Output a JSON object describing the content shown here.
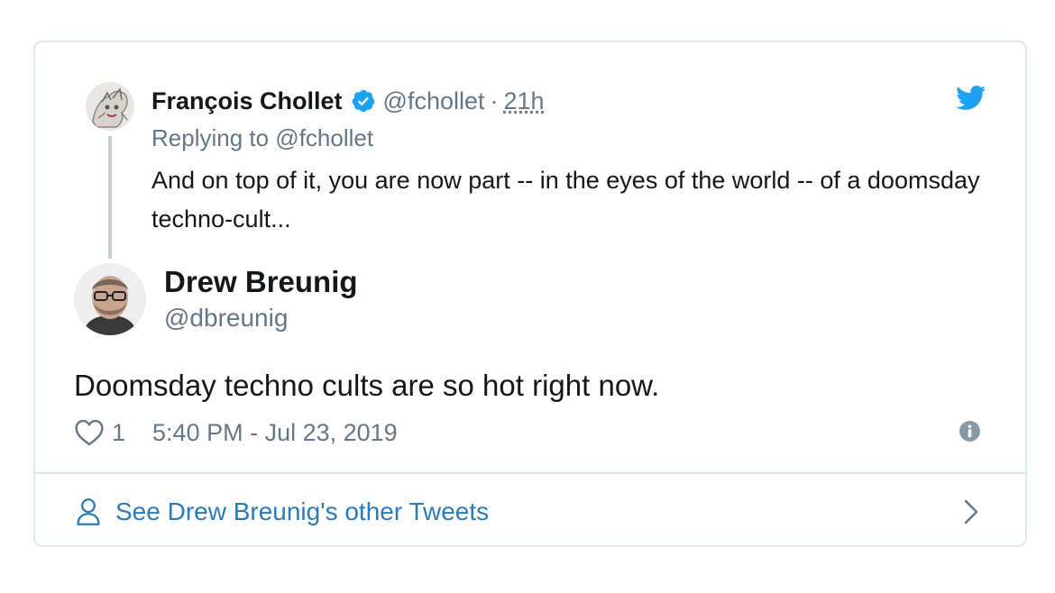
{
  "parent_tweet": {
    "author_name": "François Chollet",
    "author_handle": "@fchollet",
    "separator": "·",
    "relative_time": "21h",
    "replying_to": "Replying to @fchollet",
    "text": "And on top of it, you are now part -- in the eyes of the world -- of a doomsday techno-cult...",
    "verified_icon": "verified-badge-icon",
    "avatar_icon": "avatar"
  },
  "main_tweet": {
    "author_name": "Drew Breunig",
    "author_handle": "@dbreunig",
    "text": "Doomsday techno cults are so hot right now.",
    "like_count": "1",
    "timestamp": "5:40 PM - Jul 23, 2019",
    "like_icon": "heart-icon",
    "info_icon": "info-icon"
  },
  "footer": {
    "link_label": "See Drew Breunig's other Tweets",
    "link_icon": "person-icon",
    "chevron_icon": "chevron-right-icon"
  },
  "brand": {
    "logo_icon": "twitter-bird-icon",
    "accent_color": "#1da1f2",
    "link_color": "#2b7bb9",
    "secondary_text_color": "#657786"
  }
}
